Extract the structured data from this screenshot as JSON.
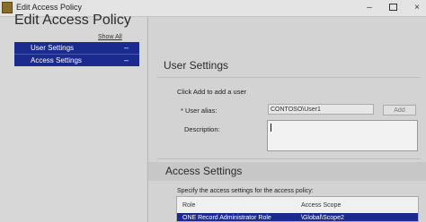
{
  "window": {
    "title": "Edit Access Policy",
    "minimize": "–",
    "close": "×"
  },
  "sidebar": {
    "heading": "Edit Access Policy",
    "show_all": "Show All",
    "items": [
      {
        "label": "User Settings",
        "toggle": "–"
      },
      {
        "label": "Access Settings",
        "toggle": "–"
      }
    ]
  },
  "user_settings": {
    "heading": "User Settings",
    "hint": "Click Add to add a user",
    "alias_label": "* User alias:",
    "alias_value": "CONTOSO\\User1",
    "add_button": "Add",
    "description_label": "Description:",
    "description_value": ""
  },
  "access_settings": {
    "heading": "Access Settings",
    "instruction": "Specify the access settings for the access policy:",
    "columns": [
      "Role",
      "Access Scope"
    ],
    "rows": [
      {
        "role": "ONE Record Administrator Role",
        "scope": "\\Global\\Scope2"
      }
    ]
  },
  "colors": {
    "selection": "#1a2a8e",
    "background": "#d2d3d2"
  }
}
